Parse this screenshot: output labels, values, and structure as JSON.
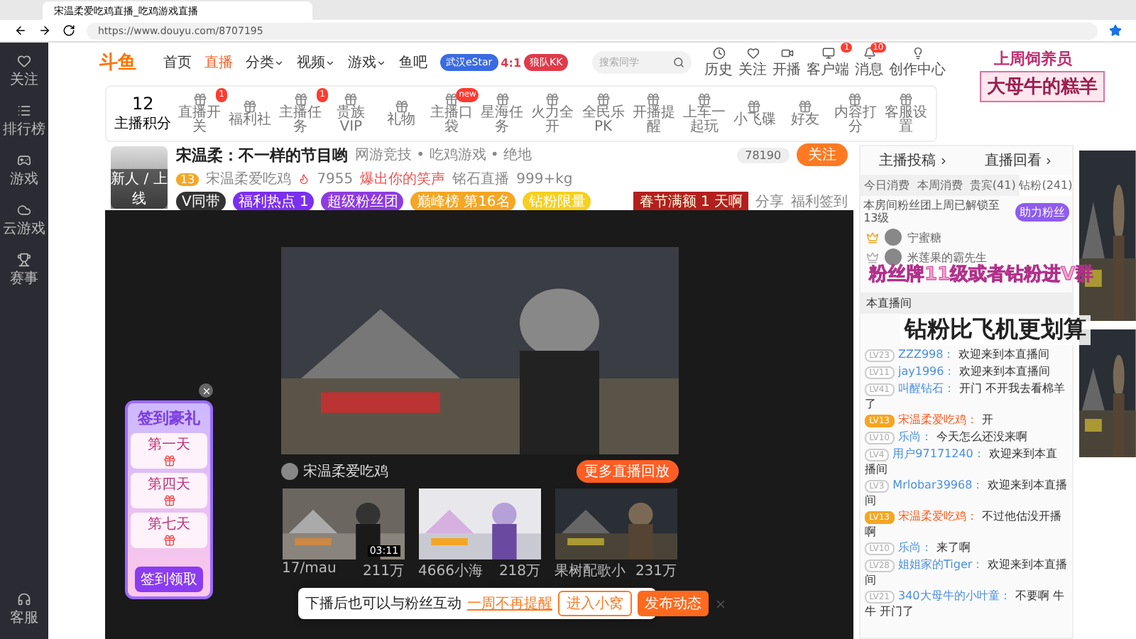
{
  "browser": {
    "tab_title": "宋温柔爱吃鸡直播_吃鸡游戏直播",
    "url": "https://www.douyu.com/8707195"
  },
  "sidebar": {
    "items": [
      {
        "label": "关注"
      },
      {
        "label": "排行榜"
      },
      {
        "label": "游戏"
      },
      {
        "label": "云游戏"
      },
      {
        "label": "赛事"
      }
    ],
    "footer": "客服"
  },
  "nav": {
    "logo": "斗鱼",
    "links": [
      {
        "label": "首页",
        "selected": false,
        "dropdown": false
      },
      {
        "label": "直播",
        "selected": true,
        "dropdown": false
      },
      {
        "label": "分类",
        "selected": false,
        "dropdown": true
      },
      {
        "label": "视频",
        "selected": false,
        "dropdown": true
      },
      {
        "label": "游戏",
        "selected": false,
        "dropdown": true
      },
      {
        "label": "鱼吧",
        "selected": false,
        "dropdown": false
      }
    ],
    "match": {
      "team_a": "武汉eStar",
      "team_b": "狼队KK",
      "score": "4:1"
    },
    "search_placeholder": "搜索同学",
    "actions": [
      {
        "label": "历史"
      },
      {
        "label": "关注"
      },
      {
        "label": "开播"
      },
      {
        "label": "客户端",
        "badge": "1"
      },
      {
        "label": "消息",
        "badge": "10"
      },
      {
        "label": "创作中心"
      }
    ]
  },
  "toolbar": {
    "score": "12",
    "score_label": "主播积分",
    "items": [
      {
        "label": "直播开关",
        "badge": "1"
      },
      {
        "label": "福利社"
      },
      {
        "label": "主播任务",
        "badge": "1"
      },
      {
        "label": "贵族VIP"
      },
      {
        "label": "礼物"
      },
      {
        "label": "主播口袋",
        "badge": "new"
      },
      {
        "label": "星海任务"
      },
      {
        "label": "火力全开"
      },
      {
        "label": "全民乐PK"
      },
      {
        "label": "开播提醒"
      },
      {
        "label": "上车一起玩"
      },
      {
        "label": "小飞碟"
      },
      {
        "label": "好友"
      },
      {
        "label": "内容打分"
      },
      {
        "label": "客服设置"
      }
    ]
  },
  "streamer": {
    "title": "宋温柔：不一样的节目哟",
    "categories": "网游竞技 • 吃鸡游戏 • 绝地",
    "level": "13",
    "name": "宋温柔爱吃鸡",
    "hot": "7955",
    "tag": "爆出你的笑声",
    "rank": "铭石直播",
    "weight": "999+kg",
    "avatar_caption": "新人 / 上线",
    "followers": "78190",
    "follow": "关注",
    "event": "春节满额",
    "event_days": "1",
    "event_unit": "天啊",
    "share": "分享",
    "report": "福利签到",
    "badges": [
      {
        "label": "V同带",
        "color": "#333333"
      },
      {
        "label": "福利热点 1",
        "color": "#7b2ff0"
      },
      {
        "label": "超级粉丝团",
        "color": "#8e3ce0"
      },
      {
        "label": "巅峰榜 第16名",
        "color": "#f5a623"
      },
      {
        "label": "钻粉限量",
        "color": "#f5d020"
      }
    ]
  },
  "video": {
    "host": "宋温柔爱吃鸡",
    "more": "更多直播回放",
    "thumbs": [
      {
        "author": "17/mau",
        "views": "211万",
        "duration": "03:11"
      },
      {
        "author": "4666小海",
        "views": "218万"
      },
      {
        "author": "果树配歌小",
        "views": "231万"
      }
    ]
  },
  "toast": {
    "text": "下播后也可以与粉丝互动",
    "later": "一周不再提醒",
    "enter": "进入小窝",
    "publish": "发布动态"
  },
  "signin": {
    "title": "签到豪礼",
    "days": [
      "第一天",
      "第四天",
      "第七天"
    ],
    "button": "签到领取"
  },
  "chat": {
    "top_tabs": [
      "主播投稿",
      "直播回看"
    ],
    "rank_tabs": [
      {
        "label": "今日消费",
        "selected": false
      },
      {
        "label": "本周消费",
        "selected": false
      },
      {
        "label": "贵宾(41)",
        "selected": false
      },
      {
        "label": "钻粉(241)",
        "selected": true
      }
    ],
    "notice": "本房间粉丝团上周已解锁至13级",
    "notice_button": "助力粉丝",
    "ranks": [
      {
        "name": "宁蜜糖",
        "color": "#f5a623"
      },
      {
        "name": "米莲果的霸先生",
        "color": "#b0b0b0"
      }
    ],
    "section": "本直播间",
    "messages": [
      {
        "level": "LV23",
        "user": "ZZZ998：",
        "text": "欢迎来到本直播间",
        "host": false
      },
      {
        "level": "LV11",
        "user": "jay1996：",
        "text": "欢迎来到本直播间",
        "host": false
      },
      {
        "level": "LV41",
        "user": "叫醒钻石：",
        "text": "开门 不开我去看棉羊了",
        "host": false
      },
      {
        "level": "LV13",
        "user": "宋温柔爱吃鸡：",
        "text": "开",
        "host": true
      },
      {
        "level": "LV10",
        "user": "乐尚：",
        "text": "今天怎么还没来啊",
        "host": false
      },
      {
        "level": "LV4",
        "user": "用户97171240：",
        "text": "欢迎来到本直播间",
        "host": false
      },
      {
        "level": "LV3",
        "user": "Mrlobar39968：",
        "text": "欢迎来到本直播间",
        "host": false
      },
      {
        "level": "LV13",
        "user": "宋温柔爱吃鸡：",
        "text": "不过他估没开播啊",
        "host": true
      },
      {
        "level": "LV10",
        "user": "乐尚：",
        "text": "来了啊",
        "host": false
      },
      {
        "level": "LV28",
        "user": "姐姐家的Tiger：",
        "text": "欢迎来到本直播间",
        "host": false
      },
      {
        "level": "LV21",
        "user": "340大母牛的小叶童：",
        "text": "不要啊 牛牛 开门了",
        "host": false
      }
    ]
  },
  "overlays": {
    "caption_top": "上周饲养员",
    "caption_name": "大母牛的糕羊",
    "banner_1": "粉丝牌11级或者钻粉进V群",
    "banner_2": "钻粉比飞机更划算"
  }
}
